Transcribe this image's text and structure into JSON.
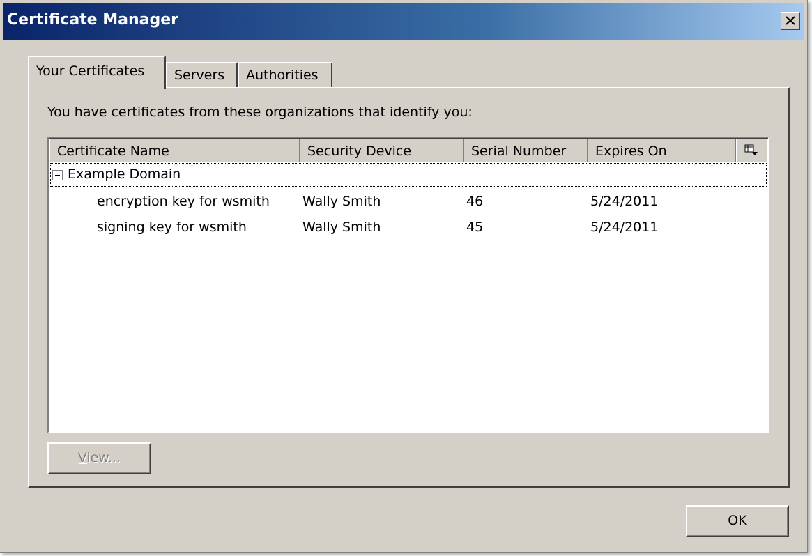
{
  "window": {
    "title": "Certificate Manager"
  },
  "tabs": [
    {
      "label": "Your Certificates",
      "active": true
    },
    {
      "label": "Servers",
      "active": false
    },
    {
      "label": "Authorities",
      "active": false
    }
  ],
  "panel": {
    "instruction": "You have certificates from these organizations that identify you:"
  },
  "table": {
    "columns": [
      "Certificate Name",
      "Security Device",
      "Serial Number",
      "Expires On"
    ],
    "group": {
      "label": "Example Domain",
      "expanded": true
    },
    "rows": [
      {
        "name": "encryption key for wsmith",
        "device": "Wally Smith",
        "serial": "46",
        "expires": "5/24/2011"
      },
      {
        "name": "signing key for wsmith",
        "device": "Wally Smith",
        "serial": "45",
        "expires": "5/24/2011"
      }
    ]
  },
  "buttons": {
    "view_accel": "V",
    "view_rest": "iew...",
    "ok": "OK"
  },
  "colors": {
    "titlebar_start": "#0a246a",
    "titlebar_end": "#a6caf0",
    "face": "#d4d0c8"
  },
  "icons": {
    "close": "close-icon",
    "column_picker": "column-picker-icon",
    "twisty": "collapse-twisty-icon"
  }
}
